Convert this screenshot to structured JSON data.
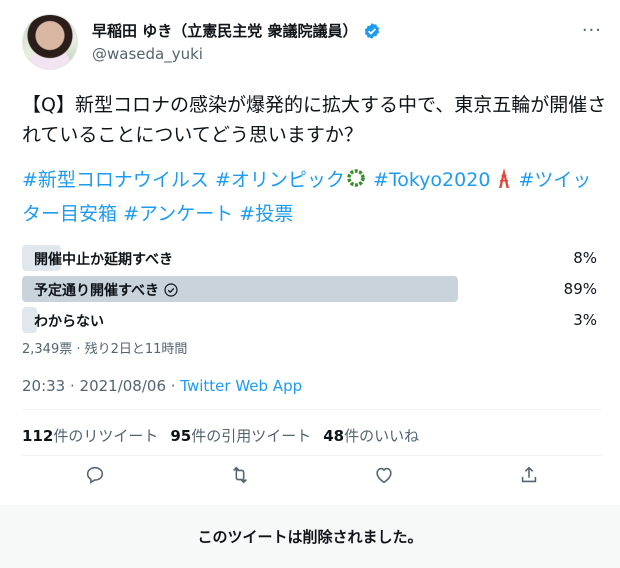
{
  "author": {
    "display_name": "早稲田 ゆき（立憲民主党 衆議院議員）",
    "handle": "@waseda_yuki",
    "verified": true,
    "avatar_icon": "user-avatar"
  },
  "more_icon": "ellipsis-icon",
  "tweet": {
    "text": "【Q】新型コロナの感染が爆発的に拡大する中で、東京五輪が開催されていることについてどう思いますか？",
    "hashtags": [
      {
        "text": "#新型コロナウイルス"
      },
      {
        "text": "#オリンピック",
        "emoji": "laurel-wreath-icon"
      },
      {
        "text": "#Tokyo2020",
        "emoji": "tokyo-tower-icon"
      },
      {
        "text": "#ツイッター目安箱"
      },
      {
        "text": "#アンケート"
      },
      {
        "text": "#投票"
      }
    ]
  },
  "poll": {
    "options": [
      {
        "label": "開催中止か延期すべき",
        "percent_text": "8%",
        "percent": 8,
        "winner": false
      },
      {
        "label": "予定通り開催すべき",
        "percent_text": "89%",
        "percent": 89,
        "winner": true
      },
      {
        "label": "わからない",
        "percent_text": "3%",
        "percent": 3,
        "winner": false
      }
    ],
    "meta": "2,349票 · 残り2日と11時間"
  },
  "timestamp": {
    "time": "20:33 · 2021/08/06 · ",
    "source": "Twitter Web App"
  },
  "stats": {
    "retweets_count": "112",
    "retweets_label": "件のリツイート",
    "quotes_count": "95",
    "quotes_label": "件の引用ツイート",
    "likes_count": "48",
    "likes_label": "件のいいね"
  },
  "actions": [
    "reply-icon",
    "retweet-icon",
    "like-icon",
    "share-icon"
  ],
  "banner": {
    "text": "このツイートは削除されました。"
  },
  "colors": {
    "accent": "#1d9bf0",
    "text": "#0f1419",
    "muted": "#536471",
    "poll_bar": "#e1e8ed",
    "poll_bar_winner": "#c8d3dc"
  }
}
